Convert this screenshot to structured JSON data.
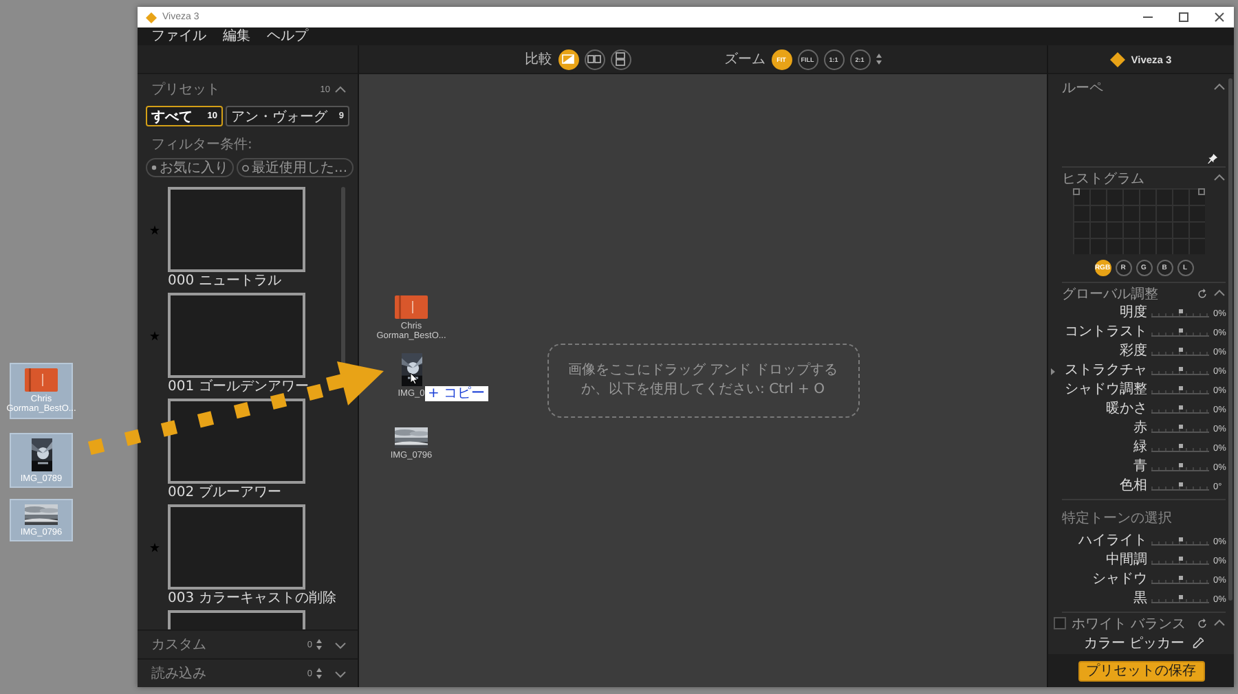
{
  "desktop": {
    "icons": [
      {
        "kind": "book",
        "label": "Chris Gorman_BestO...",
        "selected": true
      },
      {
        "kind": "nightshot",
        "label": "IMG_0789",
        "selected": true
      },
      {
        "kind": "seascape",
        "label": "IMG_0796",
        "selected": true
      }
    ]
  },
  "window": {
    "title": "Viveza 3"
  },
  "menu": [
    "ファイル",
    "編集",
    "ヘルプ"
  ],
  "presets": {
    "title": "プリセット",
    "count": "10",
    "expanded": true,
    "tabs": [
      {
        "label": "すべて",
        "count": "10",
        "selected": true
      },
      {
        "label": "アン・ヴォーグ",
        "count": "9",
        "selected": false
      }
    ],
    "filter_label": "フィルター条件:",
    "filters": [
      {
        "kind": "favorite",
        "label": "お気に入り"
      },
      {
        "kind": "recent",
        "label": "最近使用した..."
      }
    ],
    "items": [
      {
        "label": "000 ニュートラル",
        "favorite": true
      },
      {
        "label": "001 ゴールデンアワー",
        "favorite": true
      },
      {
        "label": "002 ブルーアワー",
        "favorite": false
      },
      {
        "label": "003 カラーキャストの削除",
        "favorite": true
      },
      {
        "favorite": false
      }
    ]
  },
  "sections": [
    {
      "title": "カスタム",
      "count": "0",
      "expanded": false
    },
    {
      "title": "読み込み",
      "count": "0",
      "expanded": false
    }
  ],
  "toolbar": {
    "compare_label": "比較",
    "compare_modes": [
      {
        "kind": "split",
        "selected": true
      },
      {
        "kind": "side",
        "selected": false
      },
      {
        "kind": "stack",
        "selected": false
      }
    ],
    "zoom_label": "ズーム",
    "zoom_options": [
      {
        "label": "FIT",
        "selected": true
      },
      {
        "label": "FILL",
        "selected": false
      },
      {
        "label": "1:1",
        "selected": false
      },
      {
        "label": "2:1",
        "selected": false
      }
    ]
  },
  "canvas": {
    "drop_hint": "画像をここにドラッグ アンド ドロップするか、以下を使用してください: Ctrl + O",
    "dragged": [
      {
        "kind": "book",
        "label": "Chris Gorman_BestO..."
      },
      {
        "kind": "nightshot",
        "label": "IMG_0"
      },
      {
        "kind": "seascape",
        "label": "IMG_0796"
      }
    ],
    "copy_badge": "+ コピー"
  },
  "right": {
    "brand": "Viveza 3",
    "loupe": {
      "title": "ルーペ",
      "expanded": true
    },
    "histogram": {
      "title": "ヒストグラム",
      "expanded": true,
      "channels": [
        {
          "label": "RGB",
          "selected": true
        },
        {
          "label": "R",
          "selected": false
        },
        {
          "label": "G",
          "selected": false
        },
        {
          "label": "B",
          "selected": false
        },
        {
          "label": "L",
          "selected": false
        }
      ]
    },
    "global": {
      "title": "グローバル調整",
      "expanded": true,
      "sliders": [
        {
          "label": "明度",
          "level": 0.5,
          "reading": "0%"
        },
        {
          "label": "コントラスト",
          "level": 0.5,
          "reading": "0%"
        },
        {
          "label": "彩度",
          "level": 0.5,
          "reading": "0%"
        },
        {
          "label": "ストラクチャ",
          "level": 0.5,
          "reading": "0%"
        },
        {
          "label": "シャドウ調整",
          "level": 0.5,
          "reading": "0%"
        },
        {
          "label": "暖かさ",
          "level": 0.5,
          "reading": "0%"
        },
        {
          "label": "赤",
          "level": 0.5,
          "reading": "0%"
        },
        {
          "label": "緑",
          "level": 0.5,
          "reading": "0%"
        },
        {
          "label": "青",
          "level": 0.5,
          "reading": "0%"
        },
        {
          "label": "色相",
          "level": 0.5,
          "reading": "0°"
        }
      ]
    },
    "tones": {
      "title": "特定トーンの選択",
      "sliders": [
        {
          "label": "ハイライト",
          "level": 0.5,
          "reading": "0%"
        },
        {
          "label": "中間調",
          "level": 0.5,
          "reading": "0%"
        },
        {
          "label": "シャドウ",
          "level": 0.5,
          "reading": "0%"
        },
        {
          "label": "黒",
          "level": 0.5,
          "reading": "0%"
        }
      ]
    },
    "white_balance": {
      "title": "ホワイト バランス",
      "checked": false,
      "expanded": true,
      "picker_label": "カラー ピッカー"
    },
    "save_button": "プリセットの保存"
  }
}
